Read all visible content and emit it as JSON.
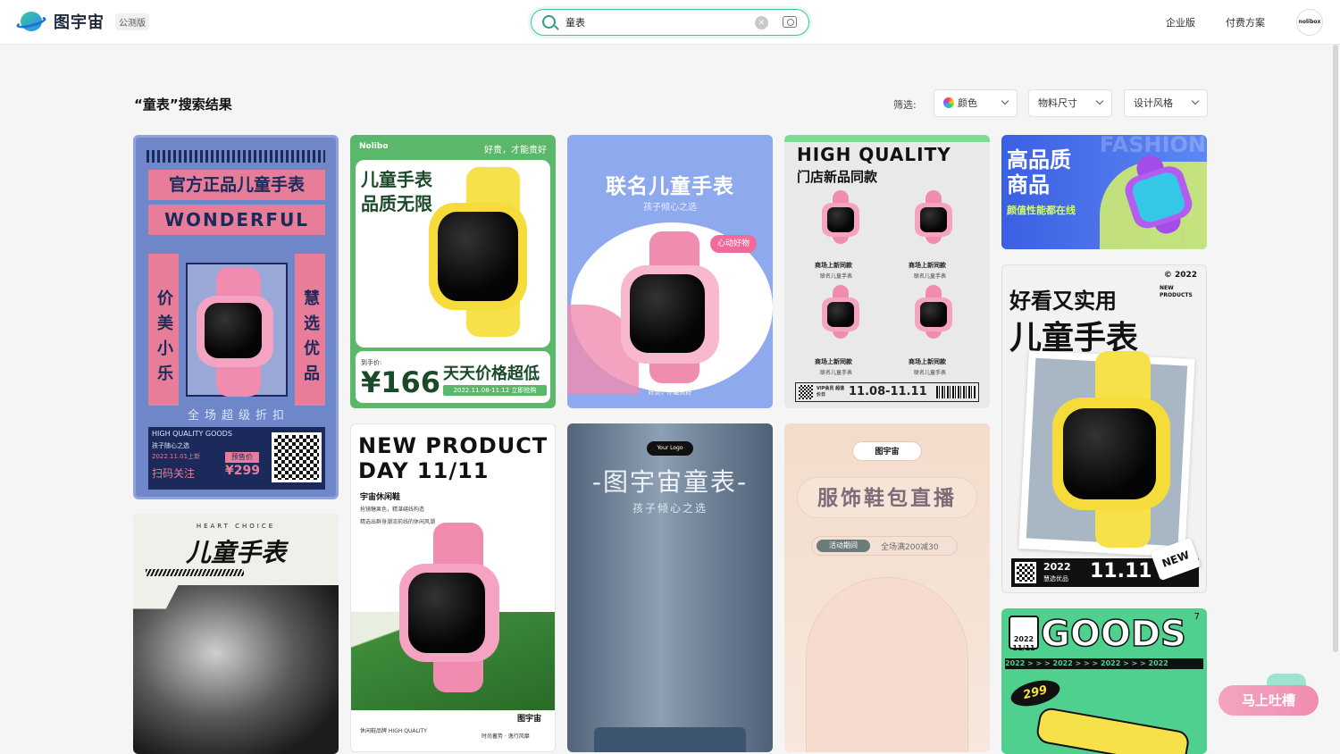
{
  "brand": {
    "name": "图宇宙",
    "badge": "公测版"
  },
  "search": {
    "query": "童表",
    "placeholder": "",
    "clear_glyph": "×"
  },
  "nav": {
    "enterprise": "企业版",
    "pricing": "付费方案",
    "avatar_text": "nolibox"
  },
  "results": {
    "title": "“童表”搜索结果"
  },
  "filters": {
    "label": "筛选:",
    "color": "颜色",
    "size": "物料尺寸",
    "style": "设计风格"
  },
  "cards": {
    "c1": {
      "line1": "官方正品儿童手表",
      "line2": "WONDERFUL",
      "left": "价美小乐",
      "right": "慧选优品",
      "promo": "全场超级折扣",
      "hq": "HIGH QUALITY GOODS",
      "sub": "孩子随心之选",
      "date": "2022.11.01上新",
      "pre": "预售价",
      "follow": "扫码关注",
      "price": "¥299"
    },
    "c2": {
      "brand": "Nolibo",
      "slogan": "好贵，才能贵好",
      "t1": "儿童手表",
      "t2": "品质无限",
      "price_label": "到手价:",
      "price": "¥166",
      "promo": "天天价格超低",
      "date": "2022.11.08-11.12 立即抢购"
    },
    "c3": {
      "title": "联名儿童手表",
      "sub": "孩子倾心之选",
      "badge": "心动好物",
      "foot": "好贵，才能贵好"
    },
    "c4": {
      "t1": "HIGH QUALITY",
      "t2": "门店新品同款",
      "label": "商场上新同款",
      "sub": "联名儿童手表",
      "vip": "VIP会员 超值价日",
      "date": "11.08-11.11"
    },
    "c5": {
      "t1": "高品质",
      "t2": "商品",
      "sub": "颜值性能都在线",
      "bg": "FASHION"
    },
    "c6": {
      "line1": "NEW PRODUCT",
      "line2": "DAY 11/11",
      "title": "宇宙休闲鞋",
      "d1": "抢镜糖果色，精湛缝线构造",
      "d2": "精选出群身潮流前线的休闲风潮",
      "foot": "休闲鞋品牌 HIGH QUALITY",
      "brand": "图宇宙",
      "slogan": "时尚蓄势 · 逸行风靡"
    },
    "c7": {
      "logo": "Your Logo",
      "title": "-图宇宙童表-",
      "sub": "孩子倾心之选"
    },
    "c8": {
      "brand": "图宇宙",
      "title": "服饰鞋包直播",
      "tag": "活动期间",
      "offer": "全场满200减30"
    },
    "c9": {
      "year": "© 2022",
      "np": "NEW PRODUCTS",
      "t1": "好看又实用",
      "t2": "儿童手表",
      "foot_year": "2022",
      "foot_sub": "慧选优品",
      "date": "11.11",
      "sticker": "NEW"
    },
    "c10": {
      "kicker": "HEART CHOICE",
      "title": "儿童手表"
    },
    "c11": {
      "cal_year": "2022",
      "cal_date": "11/11",
      "title": "GOODS",
      "strip": "2022 > > > 2022 > > > 2022 > > > 2022",
      "price": "299",
      "count": "7"
    }
  },
  "feedback": {
    "label": "马上吐槽"
  },
  "colors": {
    "accent": "#3cc4a4",
    "pink": "#f08cb0"
  }
}
